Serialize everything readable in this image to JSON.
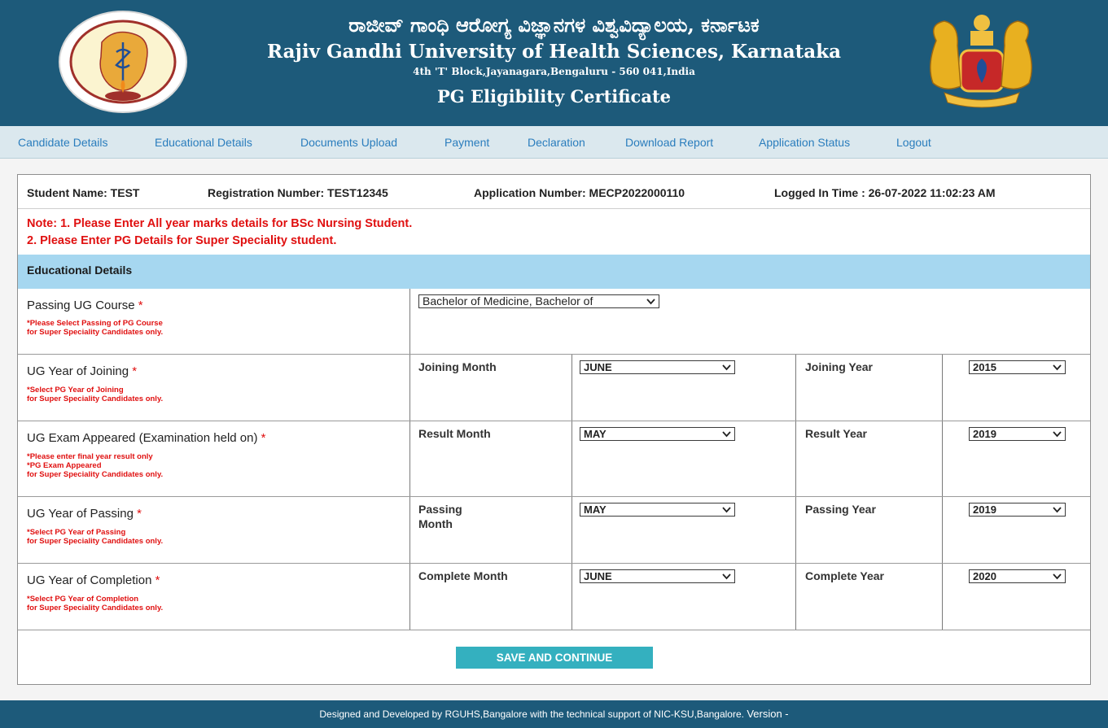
{
  "header": {
    "kannada_title": "ರಾಜೀವ್ ಗಾಂಧಿ ಆರೋಗ್ಯ ವಿಜ್ಞಾನಗಳ ವಿಶ್ವವಿದ್ಯಾಲಯ, ಕರ್ನಾಟಕ",
    "english_title": "Rajiv Gandhi University of Health Sciences, Karnataka",
    "address": "4th 'T' Block,Jayanagara,Bengaluru - 560 041,India",
    "certificate_title": "PG Eligibility Certificate"
  },
  "nav": [
    "Candidate Details",
    "Educational Details",
    "Documents Upload",
    "Payment",
    "Declaration",
    "Download Report",
    "Application Status",
    "Logout"
  ],
  "info": {
    "student_name": "Student Name: TEST",
    "registration_number": "Registration Number: TEST12345",
    "application_number": "Application Number: MECP2022000110",
    "logged_in_time": "Logged In Time : 26-07-2022 11:02:23 AM"
  },
  "notes": {
    "line1": "Note: 1. Please Enter All year marks details for BSc Nursing Student.",
    "line2": "2. Please Enter PG Details for Super Speciality student."
  },
  "section_title": "Educational Details",
  "form": {
    "ug_course": {
      "label": "Passing UG Course",
      "hint1": "*Please Select Passing of PG Course",
      "hint2": "for Super Speciality Candidates only.",
      "value": "Bachelor of Medicine, Bachelor of"
    },
    "joining": {
      "label": "UG Year of Joining",
      "hint1": "*Select PG Year of Joining",
      "hint2": "for Super Speciality Candidates only.",
      "month_label": "Joining Month",
      "month_value": "JUNE",
      "year_label": "Joining Year",
      "year_value": "2015"
    },
    "exam": {
      "label": "UG Exam Appeared (Examination held on)",
      "hint1": "*Please enter final year result only",
      "hint2": "*PG Exam Appeared",
      "hint3": "for Super Speciality Candidates only.",
      "month_label": "Result Month",
      "month_value": "MAY",
      "year_label": "Result Year",
      "year_value": "2019"
    },
    "passing": {
      "label": "UG Year of Passing",
      "hint1": "*Select PG Year of Passing",
      "hint2": "for Super Speciality Candidates only.",
      "month_label_1": "Passing",
      "month_label_2": "Month",
      "month_value": "MAY",
      "year_label": "Passing Year",
      "year_value": "2019"
    },
    "completion": {
      "label": "UG Year of Completion",
      "hint1": "*Select PG Year of Completion",
      "hint2": "for Super Speciality Candidates only.",
      "month_label": "Complete Month",
      "month_value": "JUNE",
      "year_label": "Complete Year",
      "year_value": "2020"
    },
    "required_mark": "*"
  },
  "save_button": "SAVE AND CONTINUE",
  "footer": {
    "text": "Designed and Developed by RGUHS,Bangalore with the technical support of  NIC-KSU,Bangalore.",
    "version": "Version -"
  },
  "colors": {
    "header_bg": "#1d5a7a",
    "nav_bg": "#dbe8ee",
    "nav_link": "#2a7dbd",
    "section_bg": "#a6d7f0",
    "note_red": "#e01010",
    "button_bg": "#34b0bf"
  }
}
